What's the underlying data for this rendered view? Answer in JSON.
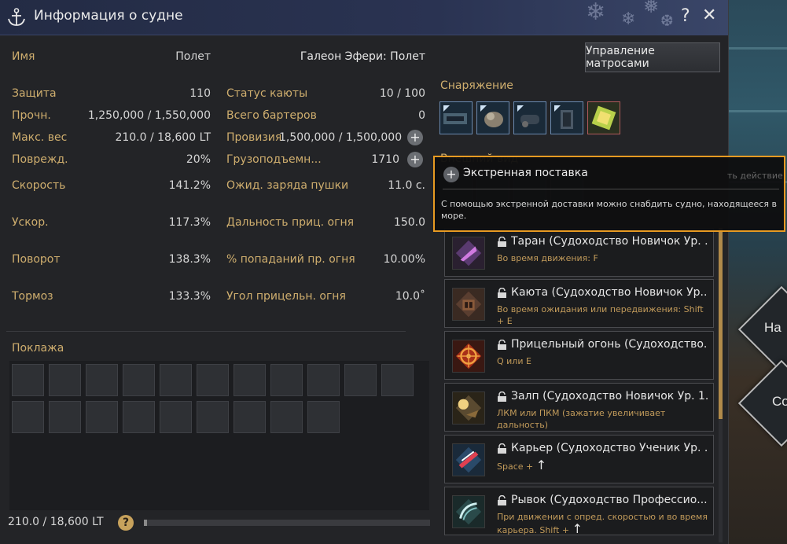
{
  "window": {
    "title": "Информация о судне",
    "help_icon": "?",
    "close_icon": "✕"
  },
  "crew_button": "Управление матросами",
  "ship": {
    "name_label": "Имя",
    "name_value": "Полет",
    "full_name": "Галеон Эфери: Полет"
  },
  "stats_left": [
    {
      "label": "Защита",
      "value": "110"
    },
    {
      "label": "Прочн.",
      "value": "1,250,000 / 1,550,000"
    },
    {
      "label": "Макс. вес",
      "value": "210.0 / 18,600 LT"
    },
    {
      "label": "Поврежд.",
      "value": "20%"
    },
    {
      "label": "Скорость",
      "value": "141.2%"
    },
    {
      "label": "Ускор.",
      "value": "117.3%"
    },
    {
      "label": "Поворот",
      "value": "138.3%"
    },
    {
      "label": "Тормоз",
      "value": "133.3%"
    }
  ],
  "stats_right": [
    {
      "label": "Статус каюты",
      "value": "10 / 100"
    },
    {
      "label": "Всего бартеров",
      "value": "0"
    },
    {
      "label": "Провизия",
      "value": "1,500,000 / 1,500,000"
    },
    {
      "label": "Грузоподъемн...",
      "value": "1710"
    },
    {
      "label": "Ожид. заряда пушки",
      "value": "11.0 с."
    },
    {
      "label": "Дальность приц. огня",
      "value": "150.0"
    },
    {
      "label": "% попаданий пр. огня",
      "value": "10.00%"
    },
    {
      "label": "Угол прицельн. огня",
      "value": "10.0˚"
    }
  ],
  "cargo": {
    "label": "Поклажа",
    "weight": "210.0 / 18,600 LT",
    "fill_fraction": 0.011
  },
  "equipment": {
    "label": "Снаряжение"
  },
  "appearance": {
    "label": "Внешний вид",
    "hidden_text": "ть действие"
  },
  "tooltip": {
    "title": "Экстренная поставка",
    "text": "С помощью экстренной доставки можно снабдить судно, находящееся в море."
  },
  "skills": [
    {
      "title": "Таран (Судоходство Новичок Ур. ...",
      "desc": "Во время движения: F",
      "arrow": ""
    },
    {
      "title": "Каюта (Судоходство Новичок Ур....",
      "desc": "Во время ожидания или передвижения: Shift + E",
      "arrow": ""
    },
    {
      "title": "Прицельный огонь (Судоходство...",
      "desc": "Q или E",
      "arrow": ""
    },
    {
      "title": "Залп (Судоходство Новичок Ур. 1...",
      "desc": "ЛКМ или ПКМ (зажатие увеличивает дальность)",
      "arrow": ""
    },
    {
      "title": "Карьер (Судоходство Ученик Ур. ...",
      "desc": "Space +",
      "arrow": "↑"
    },
    {
      "title": "Рывок (Судоходство Профессио...",
      "desc": "При движении с опред. скоростью и во время карьера. Shift +",
      "arrow": "↑"
    }
  ],
  "side_buttons": [
    {
      "label": "На"
    },
    {
      "label": "Со"
    }
  ],
  "colors": {
    "accent": "#e79a22",
    "label_gold": "#cfae6e",
    "title_bar": "#2a3352"
  }
}
